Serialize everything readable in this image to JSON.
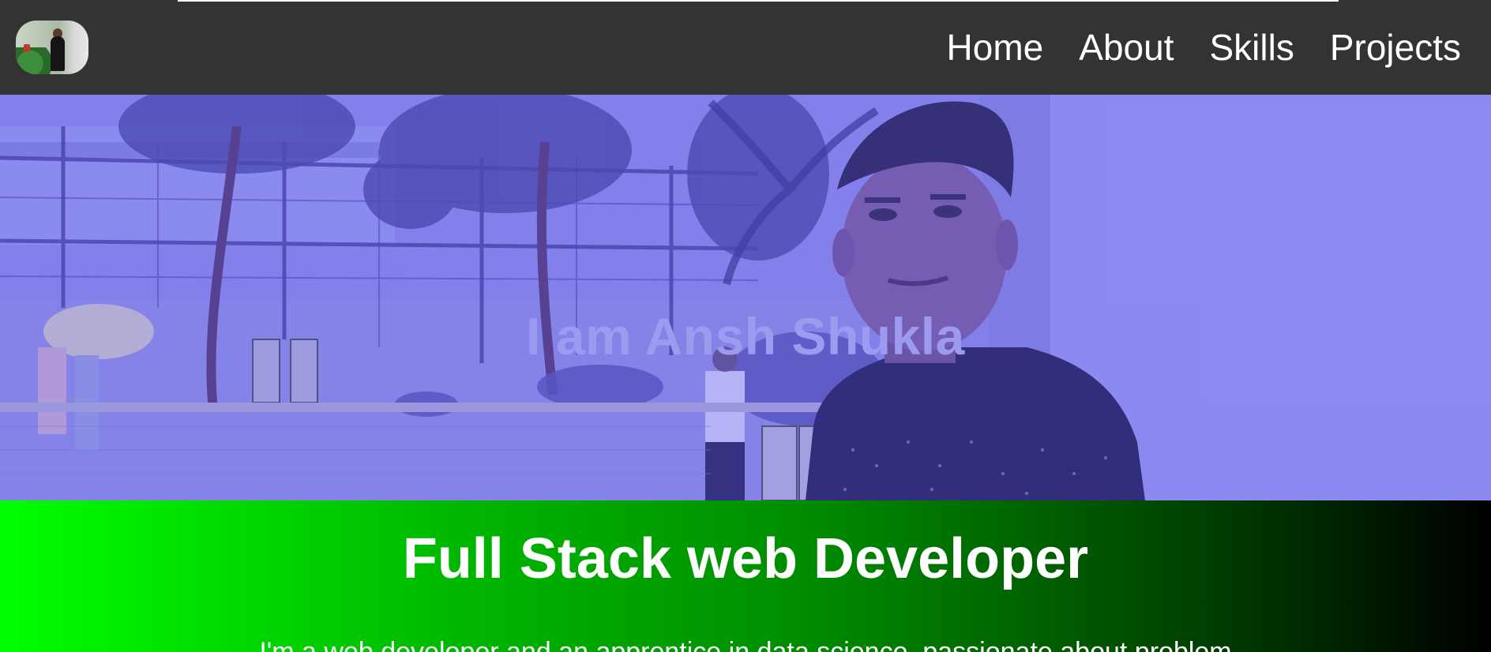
{
  "nav": {
    "links": [
      {
        "label": "Home"
      },
      {
        "label": "About"
      },
      {
        "label": "Skills"
      },
      {
        "label": "Projects"
      }
    ]
  },
  "hero": {
    "title": "I am Ansh Shukla"
  },
  "intro": {
    "title": "Full Stack web Developer",
    "text": "I'm a web developer and an apprentice in data science, passionate about problem"
  },
  "colors": {
    "navbar": "#333333",
    "hero_tint": "#8a8bdb",
    "gradient_start": "#00ff00",
    "gradient_end": "#000000"
  }
}
